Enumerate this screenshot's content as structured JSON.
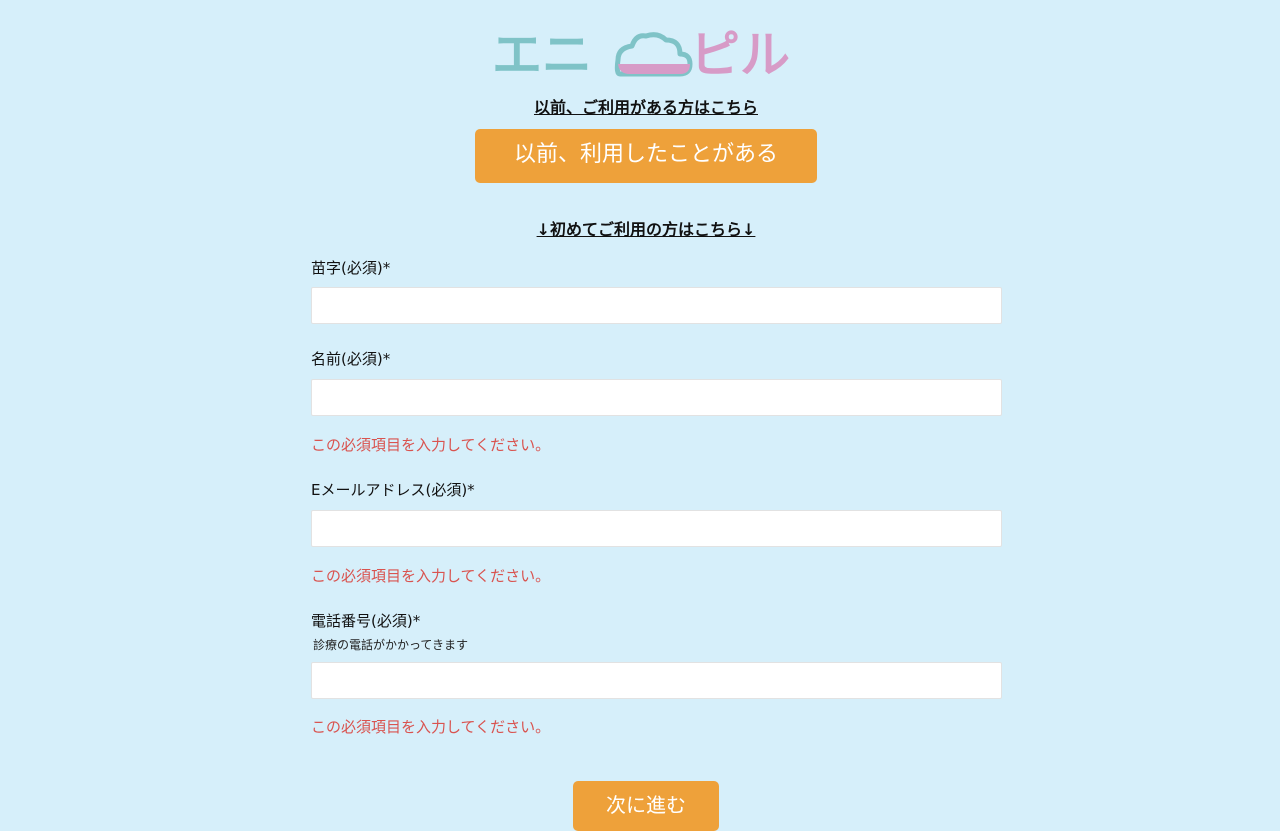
{
  "logo": {
    "text_left": "エニ",
    "text_right": "ピル",
    "cloud_icon_color_top": "#7fc3c7",
    "cloud_icon_color_bottom": "#d79bc7",
    "colors": {
      "left": "#7fc3c7",
      "right": "#d79bc7"
    }
  },
  "returning": {
    "link_text": "以前、ご利用がある方はこちら",
    "button_label": "以前、利用したことがある"
  },
  "first_time": {
    "link_text": "↓初めてご利用の方はこちら↓"
  },
  "form": {
    "last_name": {
      "label": "苗字(必須)*",
      "value": ""
    },
    "first_name": {
      "label": "名前(必須)*",
      "value": "",
      "error": "この必須項目を入力してください。"
    },
    "email": {
      "label": "Eメールアドレス(必須)*",
      "value": "",
      "error": "この必須項目を入力してください。"
    },
    "phone": {
      "label": "電話番号(必須)*",
      "hint": "診療の電話がかかってきます",
      "value": "",
      "error": "この必須項目を入力してください。"
    }
  },
  "next_button": {
    "label": "次に進む"
  },
  "colors": {
    "background": "#d6effa",
    "accent": "#eea13a",
    "error": "#d9534f"
  }
}
